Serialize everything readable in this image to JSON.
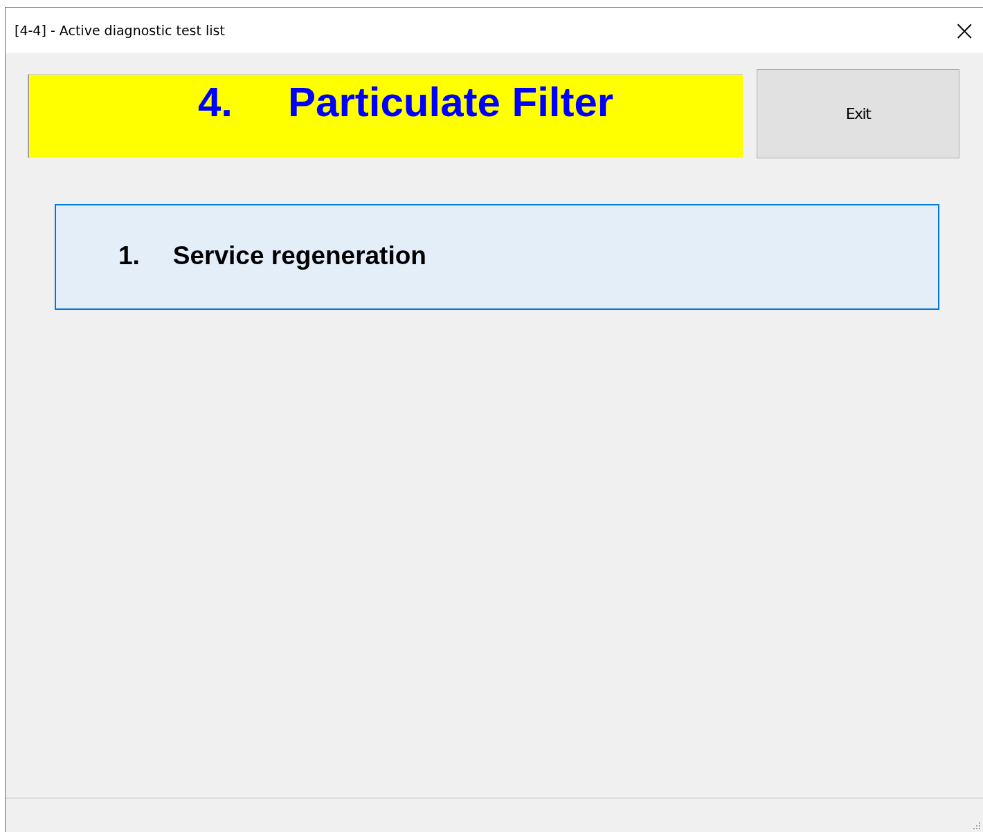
{
  "window": {
    "title": "[4-4] - Active diagnostic test list",
    "close": "×"
  },
  "header": {
    "number": "4.",
    "title": "Particulate Filter"
  },
  "exit_button": "Exit",
  "tests": [
    {
      "number": "1.",
      "label": "Service regeneration",
      "selected": true
    }
  ]
}
